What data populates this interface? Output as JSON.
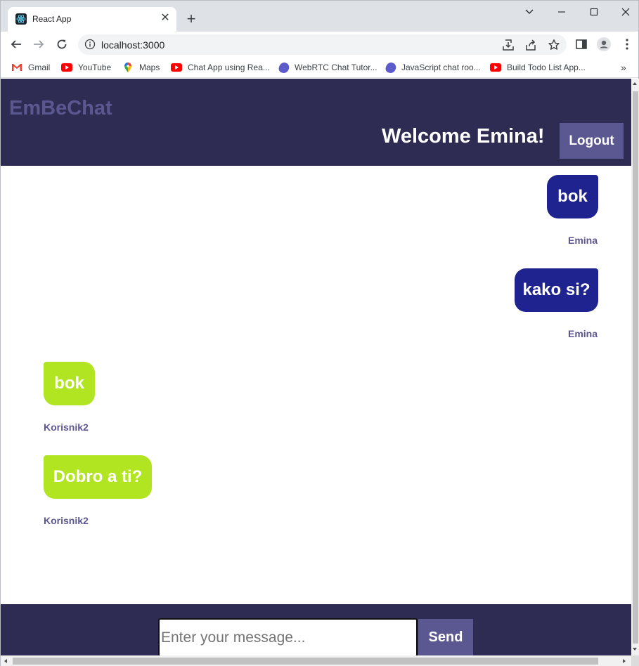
{
  "browser": {
    "tab_title": "React App",
    "tab_close": "✕",
    "new_tab": "+",
    "url": "localhost:3000",
    "bookmarks": [
      {
        "label": "Gmail",
        "icon": "gmail-icon"
      },
      {
        "label": "YouTube",
        "icon": "youtube-icon"
      },
      {
        "label": "Maps",
        "icon": "maps-icon"
      },
      {
        "label": "Chat App using Rea...",
        "icon": "youtube-icon"
      },
      {
        "label": "WebRTC Chat Tutor...",
        "icon": "orb-icon"
      },
      {
        "label": "JavaScript chat roo...",
        "icon": "orb-icon"
      },
      {
        "label": "Build Todo List App...",
        "icon": "youtube-icon"
      }
    ],
    "bookmarks_more": "»"
  },
  "app": {
    "brand": "EmBeChat",
    "welcome": "Welcome Emina!",
    "logout_label": "Logout",
    "messages": [
      {
        "text": "bok",
        "author": "Emina",
        "own": true
      },
      {
        "text": "kako si?",
        "author": "Emina",
        "own": true
      },
      {
        "text": "bok",
        "author": "Korisnik2",
        "own": false
      },
      {
        "text": "Dobro a ti?",
        "author": "Korisnik2",
        "own": false
      }
    ],
    "input_placeholder": "Enter your message...",
    "send_label": "Send"
  },
  "colors": {
    "header_bg": "#2e2c52",
    "accent": "#5b5790",
    "own_bubble": "#1e2390",
    "other_bubble": "#b1e521"
  }
}
